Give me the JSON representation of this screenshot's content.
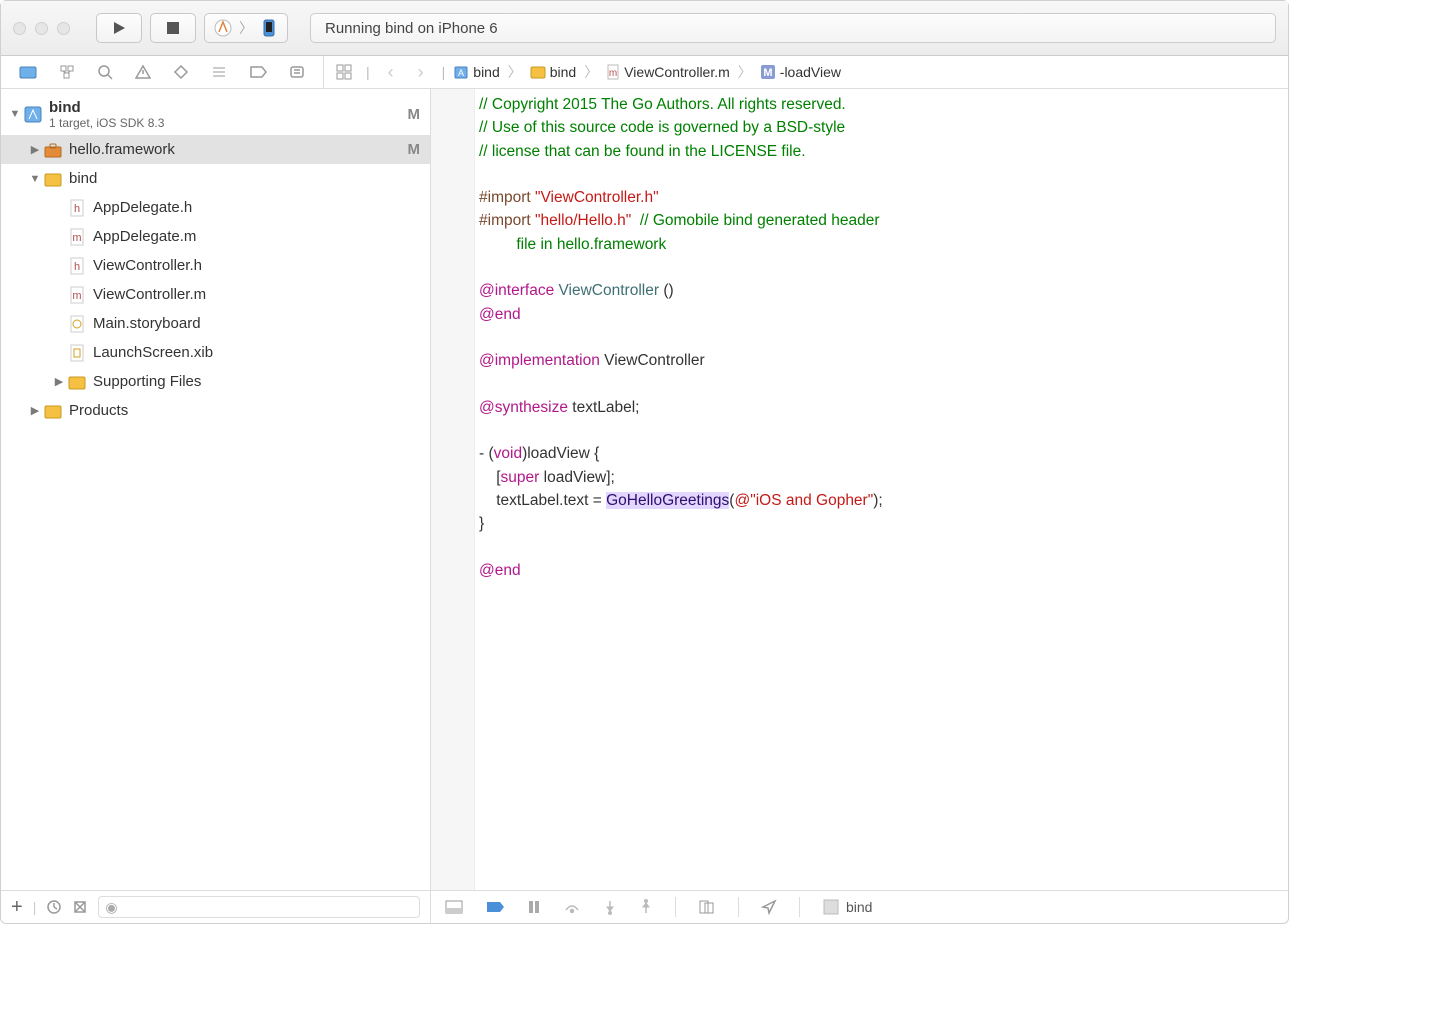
{
  "toolbar": {
    "status_text": "Running bind on iPhone 6"
  },
  "navigator": {
    "project": {
      "name": "bind",
      "subtitle": "1 target, iOS SDK 8.3",
      "scm": "M"
    },
    "tree": [
      {
        "name": "hello.framework",
        "icon": "toolbox",
        "scm": "M",
        "depth": 1,
        "expanded": false,
        "selected": true
      },
      {
        "name": "bind",
        "icon": "folder",
        "depth": 1,
        "expanded": true
      },
      {
        "name": "AppDelegate.h",
        "icon": "h",
        "depth": 2
      },
      {
        "name": "AppDelegate.m",
        "icon": "m",
        "depth": 2
      },
      {
        "name": "ViewController.h",
        "icon": "h",
        "depth": 2
      },
      {
        "name": "ViewController.m",
        "icon": "m",
        "depth": 2
      },
      {
        "name": "Main.storyboard",
        "icon": "sb",
        "depth": 2
      },
      {
        "name": "LaunchScreen.xib",
        "icon": "xib",
        "depth": 2
      },
      {
        "name": "Supporting Files",
        "icon": "folder",
        "depth": 2,
        "expanded": false
      },
      {
        "name": "Products",
        "icon": "folder",
        "depth": 1,
        "expanded": false
      }
    ]
  },
  "jumpbar": {
    "crumbs": [
      {
        "icon": "proj",
        "label": "bind"
      },
      {
        "icon": "folder",
        "label": "bind"
      },
      {
        "icon": "m",
        "label": "ViewController.m"
      },
      {
        "icon": "M",
        "label": "-loadView"
      }
    ]
  },
  "code": {
    "l1": "// Copyright 2015 The Go Authors. All rights reserved.",
    "l2": "// Use of this source code is governed by a BSD-style",
    "l3": "// license that can be found in the LICENSE file.",
    "l5a": "#import ",
    "l5b": "\"ViewController.h\"",
    "l6a": "#import ",
    "l6b": "\"hello/Hello.h\"",
    "l6c": "  // Gomobile bind generated header",
    "l7": "file in hello.framework",
    "l9a": "@interface",
    "l9b": " ViewController ",
    "l9c": "()",
    "l10": "@end",
    "l12a": "@implementation",
    "l12b": " ViewController",
    "l14a": "@synthesize",
    "l14b": " textLabel;",
    "l16a": "- (",
    "l16b": "void",
    "l16c": ")loadView {",
    "l17a": "    [",
    "l17b": "super",
    "l17c": " loadView];",
    "l18a": "    textLabel.text = ",
    "l18b": "GoHelloGreetings",
    "l18c": "(",
    "l18d": "@\"iOS and Gopher\"",
    "l18e": ");",
    "l19": "}",
    "l21": "@end"
  },
  "bottombar": {
    "scheme": "bind"
  }
}
